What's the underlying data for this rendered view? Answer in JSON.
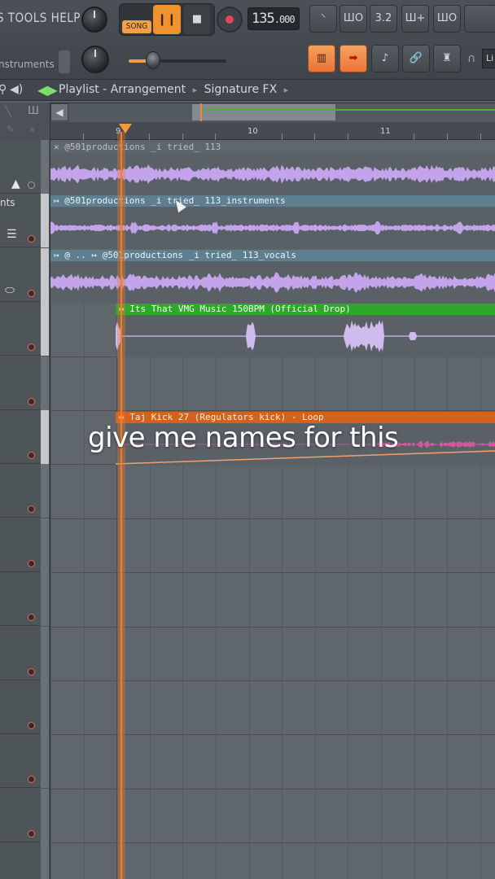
{
  "menu": {
    "text": "S TOOLS HELP"
  },
  "transport": {
    "mode_label": "SONG",
    "pause_glyph": "❙❙",
    "stop_glyph": "■",
    "tempo_int": "135",
    "tempo_frac": ".000"
  },
  "toolbar": {
    "instrument_label": "nstruments",
    "tool_buttons": [
      "⸌",
      "ШО",
      "3.2",
      "Ш+",
      "ШО"
    ],
    "snap_label": "Li"
  },
  "playlist": {
    "title": "Playlist - Arrangement",
    "separator": "▸",
    "pattern": "Signature FX"
  },
  "ruler": {
    "bars": [
      "9",
      "10",
      "11"
    ]
  },
  "tracks": [
    {
      "header_label": "",
      "glyph": "▲"
    },
    {
      "header_label": "nts",
      "glyph": "☰"
    },
    {
      "header_label": "",
      "glyph": "⬭"
    },
    {
      "header_label": "",
      "glyph": ""
    },
    {
      "header_label": "",
      "glyph": ""
    },
    {
      "header_label": "",
      "glyph": ""
    }
  ],
  "clips": [
    {
      "name": "@501productions _i tried_ 113",
      "prefix": "✕",
      "color": "#5d6469"
    },
    {
      "name": "@501productions _i tried_ 113_instruments",
      "prefix": "↦",
      "color": "#5b7b8c"
    },
    {
      "name": "@501productions _i tried_ 113_vocals",
      "prefix": "↦ @ .. ↦",
      "color": "#5b7b8c"
    },
    {
      "name": "Its That VMG Music 150BPM (Official Drop)",
      "prefix": "↦",
      "color": "#2ea72a"
    },
    {
      "name": "Taj Kick 27 (Regulators kick) - Loop",
      "prefix": "↦",
      "color": "#d2621c"
    }
  ],
  "overlay": {
    "caption": "give me names for this"
  },
  "colors": {
    "accent_orange": "#f08a30",
    "waveform_purple": "#c9a6f0",
    "drop_green": "#2ea72a",
    "kick_orange": "#d2621c"
  }
}
